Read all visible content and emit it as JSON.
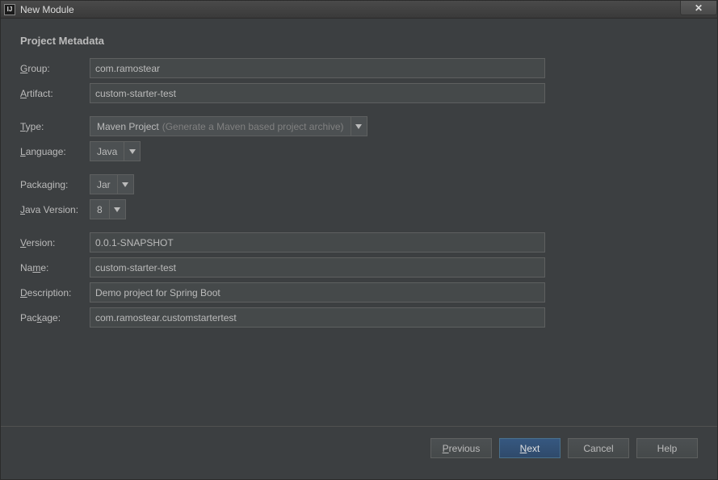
{
  "window": {
    "title": "New Module",
    "icon_text": "IJ"
  },
  "section_title": "Project Metadata",
  "labels": {
    "group": "Group:",
    "artifact": "Artifact:",
    "type": "Type:",
    "language": "Language:",
    "packaging": "Packaging:",
    "javaVersion": "Java Version:",
    "version": "Version:",
    "name": "Name:",
    "description": "Description:",
    "package": "Package:"
  },
  "values": {
    "group": "com.ramostear",
    "artifact": "custom-starter-test",
    "type": "Maven Project",
    "type_hint": "(Generate a Maven based project archive)",
    "language": "Java",
    "packaging": "Jar",
    "javaVersion": "8",
    "version": "0.0.1-SNAPSHOT",
    "name": "custom-starter-test",
    "description": "Demo project for Spring Boot",
    "package": "com.ramostear.customstartertest"
  },
  "buttons": {
    "previous": "Previous",
    "next": "Next",
    "cancel": "Cancel",
    "help": "Help"
  }
}
